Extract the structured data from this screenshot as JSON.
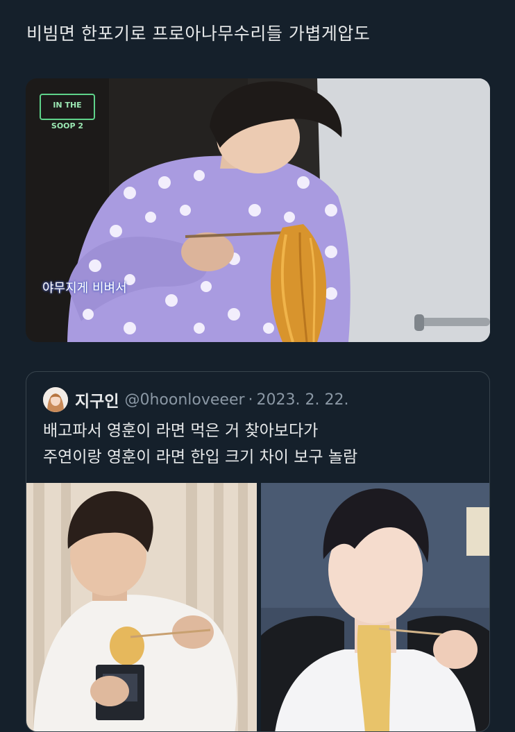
{
  "tweet": {
    "text": "비빔면 한포기로 프로아나무수리들 가볍게압도"
  },
  "media": {
    "logo_text": "IN THE SOOP 2",
    "caption": "야무지게 비벼서"
  },
  "quote": {
    "name": "지구인",
    "handle": "@0hoonloveeer",
    "separator": "·",
    "date": "2023. 2. 22.",
    "lines": [
      "배고파서 영훈이 라면 먹은 거 찾아보다가",
      "주연이랑 영훈이 라면 한입 크기 차이 보구 놀람"
    ]
  },
  "colors": {
    "background": "#15202b",
    "text": "#e7e9ea",
    "secondary_text": "#8b98a5",
    "border": "#38444d",
    "sweater": "#a99be0"
  },
  "icons": {
    "avatar": "user-avatar"
  }
}
